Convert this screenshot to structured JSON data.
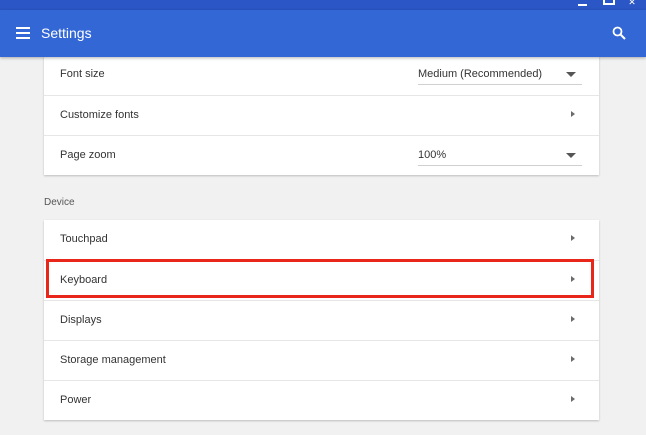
{
  "app": {
    "title": "Settings"
  },
  "icons": {
    "menu": "hamburger-menu-icon",
    "search": "search-icon",
    "chevron": "chevron-right-icon",
    "dropdown": "caret-down-icon"
  },
  "colors": {
    "appbar": "#3367d6",
    "titlebar": "#2a56c6",
    "highlight": "#e8261a",
    "background": "#f1f1f1"
  },
  "appearance": {
    "font_size": {
      "label": "Font size",
      "value": "Medium (Recommended)"
    },
    "customize_fonts": {
      "label": "Customize fonts"
    },
    "page_zoom": {
      "label": "Page zoom",
      "value": "100%"
    }
  },
  "device": {
    "header": "Device",
    "items": [
      {
        "label": "Touchpad"
      },
      {
        "label": "Keyboard"
      },
      {
        "label": "Displays"
      },
      {
        "label": "Storage management"
      },
      {
        "label": "Power"
      }
    ]
  }
}
